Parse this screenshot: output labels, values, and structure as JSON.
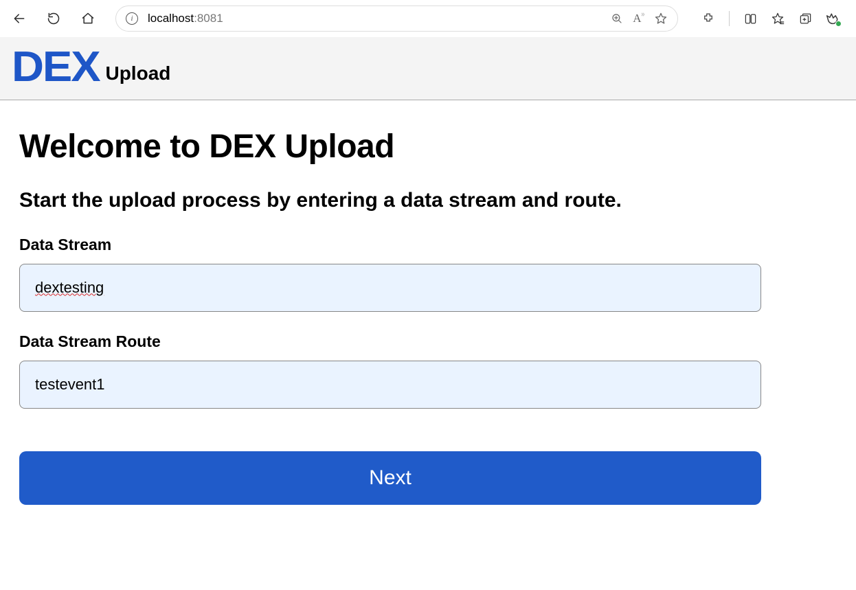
{
  "browser": {
    "url_host": "localhost",
    "url_port": ":8081"
  },
  "header": {
    "logo": "DEX",
    "sub": "Upload"
  },
  "page": {
    "title": "Welcome to DEX Upload",
    "subtitle": "Start the upload process by entering a data stream and route.",
    "fields": {
      "data_stream": {
        "label": "Data Stream",
        "value": "dextesting"
      },
      "data_stream_route": {
        "label": "Data Stream Route",
        "value": "testevent1"
      }
    },
    "next_label": "Next"
  }
}
